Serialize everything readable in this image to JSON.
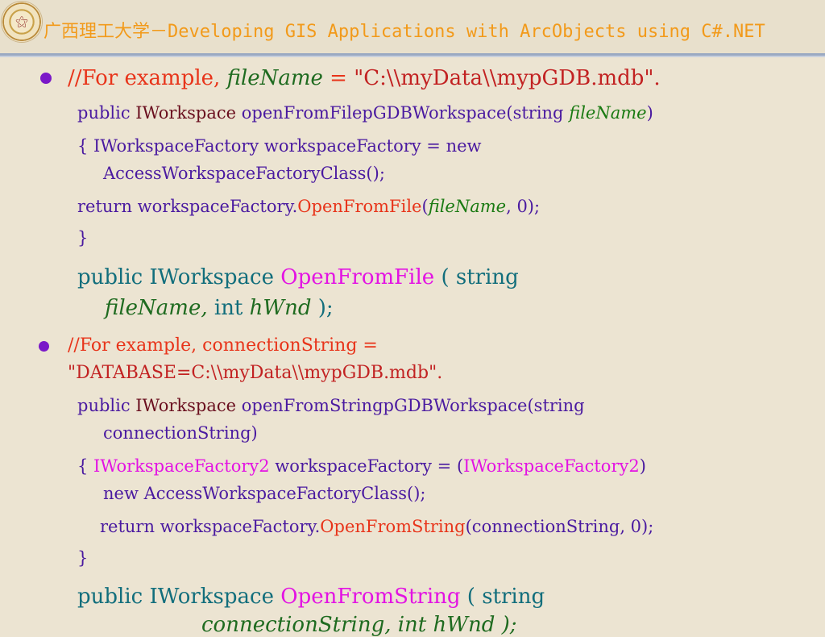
{
  "header": {
    "title": "广西理工大学－Developing GIS Applications with ArcObjects using C#.NET"
  },
  "bullet1": {
    "line1": [
      "//For example, ",
      "fileName",
      " = ",
      "\"C:\\\\myData\\\\mypGDB.mdb\"."
    ],
    "line2": [
      "public ",
      "IWorkspace",
      " openFromFilepGDBWorkspace(string ",
      "fileName",
      ")"
    ],
    "line3": "{ IWorkspaceFactory workspaceFactory = new",
    "line4": "AccessWorkspaceFactoryClass();",
    "line5": [
      "return workspaceFactory.",
      "OpenFromFile",
      "(",
      "fileName",
      ", 0);"
    ],
    "line6": "}",
    "sig1": [
      "public IWorkspace ",
      "OpenFromFile",
      " ( string"
    ],
    "sig2": [
      "fileName,",
      "  int ",
      "hWnd",
      " );"
    ]
  },
  "bullet2": {
    "line1": "//For example, connectionString =",
    "line2": "\"DATABASE=C:\\\\myData\\\\mypGDB.mdb\".",
    "line3": [
      "public ",
      "IWorkspace",
      " openFromStringpGDBWorkspace(string"
    ],
    "line4": "connectionString)",
    "line5": [
      "{ ",
      "IWorkspaceFactory2",
      " workspaceFactory = (",
      "IWorkspaceFactory2",
      ")"
    ],
    "line6": "new AccessWorkspaceFactoryClass();",
    "line7": [
      "return workspaceFactory.",
      "OpenFromString",
      "(connectionString, 0);"
    ],
    "line8": "}",
    "sig1": [
      "public IWorkspace ",
      "OpenFromString",
      " ( string"
    ],
    "sig2": [
      "connectionString, int hWnd );"
    ]
  }
}
